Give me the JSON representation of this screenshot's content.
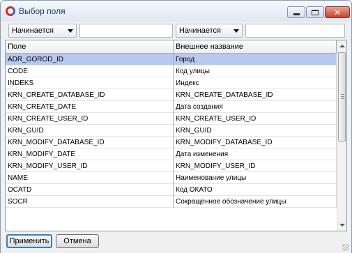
{
  "window": {
    "title": "Выбор поля"
  },
  "filters": {
    "left_mode": "Начинается",
    "left_value": "",
    "right_mode": "Начинается",
    "right_value": ""
  },
  "grid": {
    "columns": [
      "Поле",
      "Внешнее название"
    ],
    "rows": [
      {
        "field": "ADR_GOROD_ID",
        "name": "Город",
        "selected": true
      },
      {
        "field": "CODE",
        "name": "Код улицы"
      },
      {
        "field": "INDEKS",
        "name": "Индекс"
      },
      {
        "field": "KRN_CREATE_DATABASE_ID",
        "name": "KRN_CREATE_DATABASE_ID"
      },
      {
        "field": "KRN_CREATE_DATE",
        "name": "Дата создания"
      },
      {
        "field": "KRN_CREATE_USER_ID",
        "name": "KRN_CREATE_USER_ID"
      },
      {
        "field": "KRN_GUID",
        "name": "KRN_GUID"
      },
      {
        "field": "KRN_MODIFY_DATABASE_ID",
        "name": "KRN_MODIFY_DATABASE_ID"
      },
      {
        "field": "KRN_MODIFY_DATE",
        "name": "Дата изменения"
      },
      {
        "field": "KRN_MODIFY_USER_ID",
        "name": "KRN_MODIFY_USER_ID"
      },
      {
        "field": "NAME",
        "name": "Наименование улицы"
      },
      {
        "field": "OCATD",
        "name": "Код ОКАТО"
      },
      {
        "field": "SOCR",
        "name": "Сокращенное обозначение улицы"
      }
    ]
  },
  "buttons": {
    "apply": "Применить",
    "cancel": "Отмена"
  },
  "icons": {
    "app": "app-logo-icon",
    "minimize": "minimize-icon",
    "maximize": "maximize-icon",
    "close": "close-icon"
  },
  "colors": {
    "selection": "#b8c9f0",
    "close_button": "#c4452e"
  }
}
